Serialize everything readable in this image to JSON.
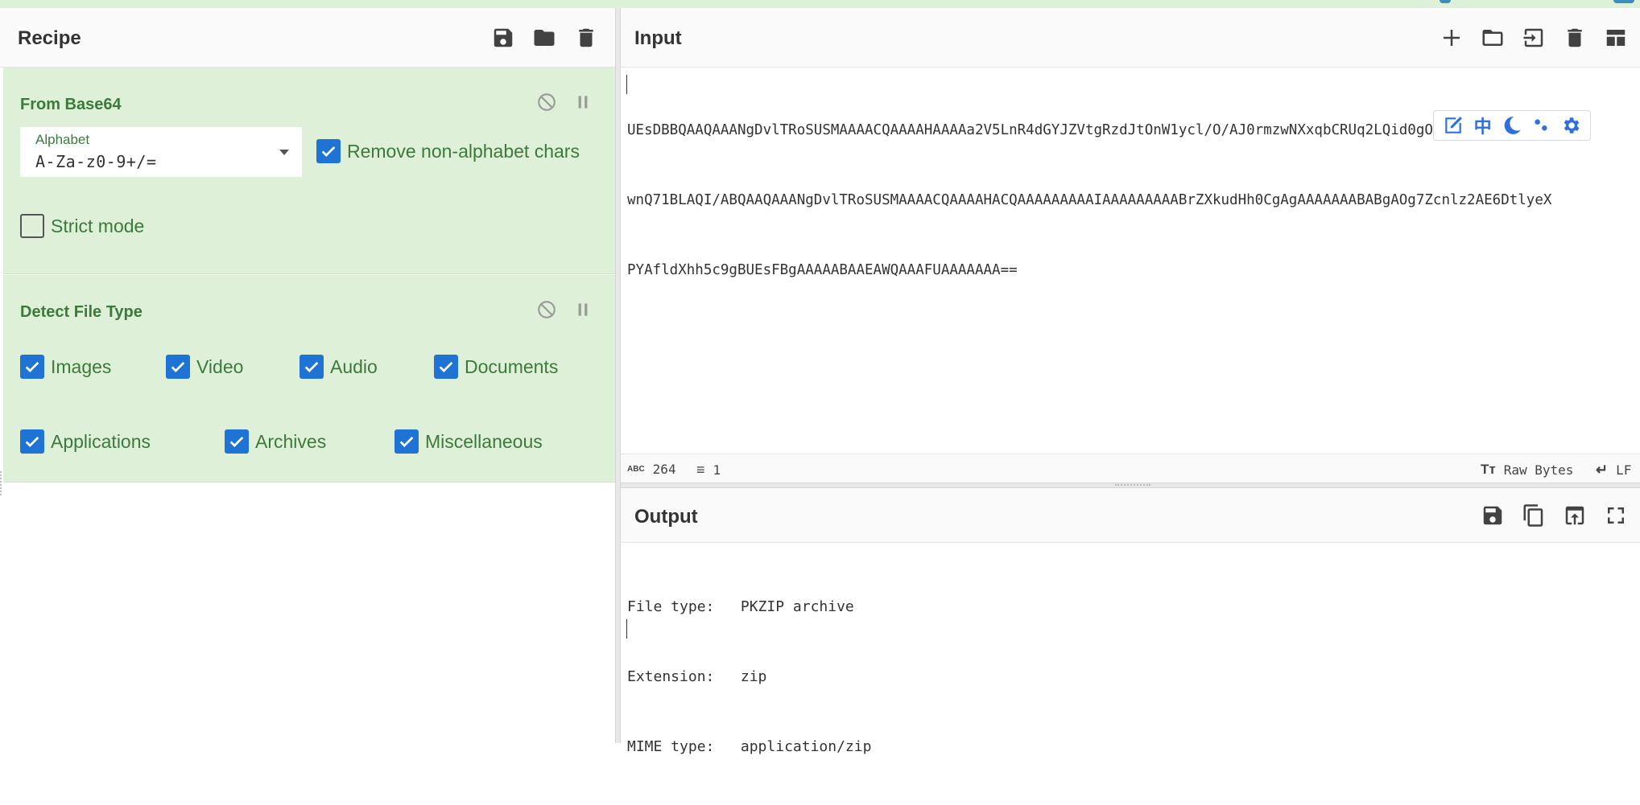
{
  "recipe": {
    "title": "Recipe",
    "icons": [
      "save-icon",
      "folder-icon",
      "trash-icon"
    ],
    "operations": [
      {
        "name": "From Base64",
        "alphabet_label": "Alphabet",
        "alphabet_value": "A-Za-z0-9+/=",
        "remove_non_alphabet": {
          "label": "Remove non-alphabet chars",
          "checked": true
        },
        "strict_mode": {
          "label": "Strict mode",
          "checked": false
        }
      },
      {
        "name": "Detect File Type",
        "options": [
          {
            "label": "Images",
            "checked": true
          },
          {
            "label": "Video",
            "checked": true
          },
          {
            "label": "Audio",
            "checked": true
          },
          {
            "label": "Documents",
            "checked": true
          },
          {
            "label": "Applications",
            "checked": true
          },
          {
            "label": "Archives",
            "checked": true
          },
          {
            "label": "Miscellaneous",
            "checked": true
          }
        ]
      }
    ]
  },
  "input": {
    "title": "Input",
    "lines": [
      "UEsDBBQAAQAAANgDvlTRoSUSMAAAACQAAAAHAAAAa2V5LnR4dGYJZVtgRzdJtOnW1ycl/O/AJ0rmzwNXxqbCRUq2LQid0gO2yXaPBcc9baLIA",
      "wnQ71BLAQI/ABQAAQAAANgDvlTRoSUSMAAAACQAAAAHACQAAAAAAAAAIAAAAAAAAABrZXkudHh0CgAgAAAAAAABABgAOg7Zcnlz2AE6DtlyeX",
      "PYAfldXhh5c9gBUEsFBgAAAAABAAEAWQAAAFUAAAAAAA=="
    ],
    "floatbar_char": "中",
    "status": {
      "length": "264",
      "lines": "1",
      "encoding": "Raw Bytes",
      "eol": "LF"
    }
  },
  "output": {
    "title": "Output",
    "lines": [
      "File type:   PKZIP archive",
      "Extension:   zip",
      "MIME type:   application/zip"
    ]
  },
  "colors": {
    "op_background": "#dff0d8",
    "op_text": "#3c7a3c",
    "checkbox": "#1e73d4"
  }
}
